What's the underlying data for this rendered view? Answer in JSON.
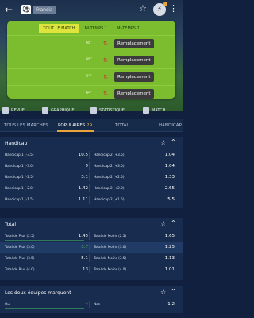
{
  "header": {
    "team_name": "Francia"
  },
  "timeline": {
    "tabs": [
      "TOUT LE MATCH",
      "MI-TEMPS 1",
      "MI-TEMPS 2"
    ],
    "events": [
      {
        "minute": "68'",
        "label": "Remplacement"
      },
      {
        "minute": "68'",
        "label": "Remplacement"
      },
      {
        "minute": "64'",
        "label": "Remplacement"
      },
      {
        "minute": "64'",
        "label": "Remplacement"
      }
    ]
  },
  "tools": [
    "REVUE",
    "GRAPHIQUE",
    "STATISTIQUE",
    "MATCH"
  ],
  "market_tabs": {
    "all": "TOUS LES MARCHÉS",
    "popular": "POPULAIRES",
    "popular_count": "29",
    "total": "TOTAL",
    "handicap": "HANDICAP"
  },
  "handicap": {
    "title": "Handicap",
    "rows": [
      {
        "left": "Handicap 1 (-3.5)",
        "left_odd": "10.5",
        "right": "Handicap 2 (+3.5)",
        "right_odd": "1.04"
      },
      {
        "left": "Handicap 1 (-3.0)",
        "left_odd": "9",
        "right": "Handicap 2 (+3.0)",
        "right_odd": "1.04"
      },
      {
        "left": "Handicap 1 (-2.5)",
        "left_odd": "3.1",
        "right": "Handicap 2 (+2.5)",
        "right_odd": "1.33"
      },
      {
        "left": "Handicap 1 (-2.0)",
        "left_odd": "1.42",
        "right": "Handicap 2 (+2.0)",
        "right_odd": "2.65"
      },
      {
        "left": "Handicap 1 (-1.5)",
        "left_odd": "1.11",
        "right": "Handicap 2 (+1.5)",
        "right_odd": "5.5"
      }
    ]
  },
  "total": {
    "title": "Total",
    "rows": [
      {
        "left": "Total de Plus (2.5)",
        "left_odd": "1.45",
        "right": "Total de Moins (2.5)",
        "right_odd": "1.65"
      },
      {
        "left": "Total de Plus (3.0)",
        "left_odd": "3.7",
        "right": "Total de Moins (3.0)",
        "right_odd": "1.25"
      },
      {
        "left": "Total de Plus (3.5)",
        "left_odd": "5.1",
        "right": "Total de Moins (3.5)",
        "right_odd": "1.13"
      },
      {
        "left": "Total de Plus (4.0)",
        "left_odd": "13",
        "right": "Total de Moins (4.0)",
        "right_odd": "1.01"
      }
    ]
  },
  "btts": {
    "title": "Les deux équipes marquent",
    "rows": [
      {
        "left": "Oui",
        "left_odd": "4",
        "right": "Non",
        "right_odd": "1.2"
      }
    ]
  },
  "colors": {
    "accent": "#e8a33c",
    "green_odd": "#5dc25d",
    "pitch": "#7bbd2f"
  }
}
